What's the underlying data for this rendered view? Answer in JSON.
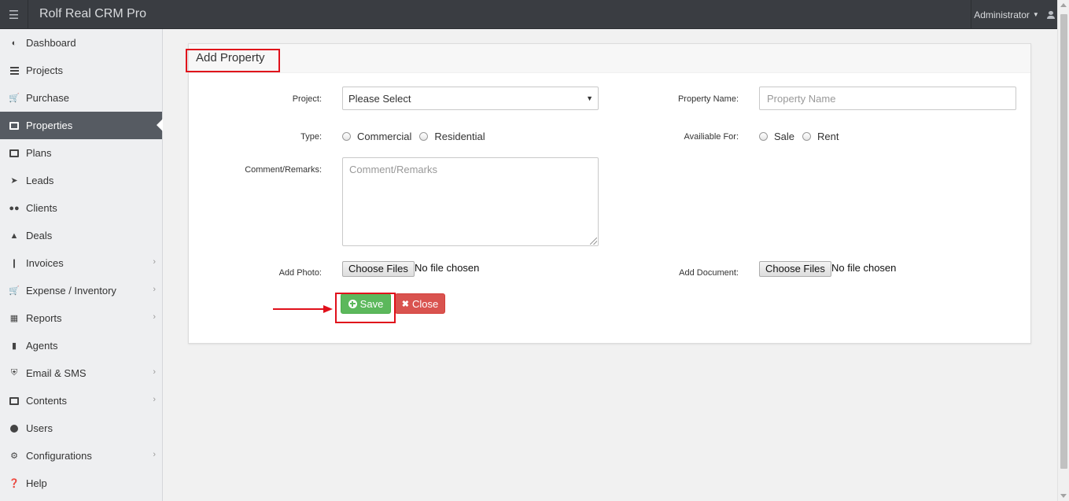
{
  "app": {
    "title": "Rolf Real CRM Pro",
    "user": "Administrator"
  },
  "sidebar": {
    "items": [
      {
        "label": "Dashboard",
        "icon": "dashboard-icon"
      },
      {
        "label": "Projects",
        "icon": "server-icon"
      },
      {
        "label": "Purchase",
        "icon": "cart-icon"
      },
      {
        "label": "Properties",
        "icon": "building-icon",
        "active": true
      },
      {
        "label": "Plans",
        "icon": "briefcase-icon"
      },
      {
        "label": "Leads",
        "icon": "rocket-icon"
      },
      {
        "label": "Clients",
        "icon": "users-icon"
      },
      {
        "label": "Deals",
        "icon": "thumbs-up-icon"
      },
      {
        "label": "Invoices",
        "icon": "pin-icon",
        "expandable": true
      },
      {
        "label": "Expense / Inventory",
        "icon": "cart-icon",
        "expandable": true
      },
      {
        "label": "Reports",
        "icon": "table-icon",
        "expandable": true
      },
      {
        "label": "Agents",
        "icon": "lock-icon"
      },
      {
        "label": "Email & SMS",
        "icon": "shield-icon",
        "expandable": true
      },
      {
        "label": "Contents",
        "icon": "newspaper-icon",
        "expandable": true
      },
      {
        "label": "Users",
        "icon": "user-icon"
      },
      {
        "label": "Configurations",
        "icon": "cogs-icon",
        "expandable": true
      },
      {
        "label": "Help",
        "icon": "question-icon"
      }
    ]
  },
  "form": {
    "title": "Add Property",
    "project_label": "Project:",
    "project_value": "Please Select",
    "property_name_label": "Property Name:",
    "property_name_placeholder": "Property Name",
    "type_label": "Type:",
    "type_options": [
      "Commercial",
      "Residential"
    ],
    "available_label": "Availiable For:",
    "available_options": [
      "Sale",
      "Rent"
    ],
    "comment_label": "Comment/Remarks:",
    "comment_placeholder": "Comment/Remarks",
    "photo_label": "Add Photo:",
    "document_label": "Add Document:",
    "choose_files": "Choose Files",
    "no_file": "No file chosen",
    "save_label": "Save",
    "close_label": "Close"
  },
  "colors": {
    "accent_save": "#5cb85c",
    "accent_close": "#d9534f",
    "annotation": "#e0101b",
    "topbar": "#3a3d42"
  }
}
